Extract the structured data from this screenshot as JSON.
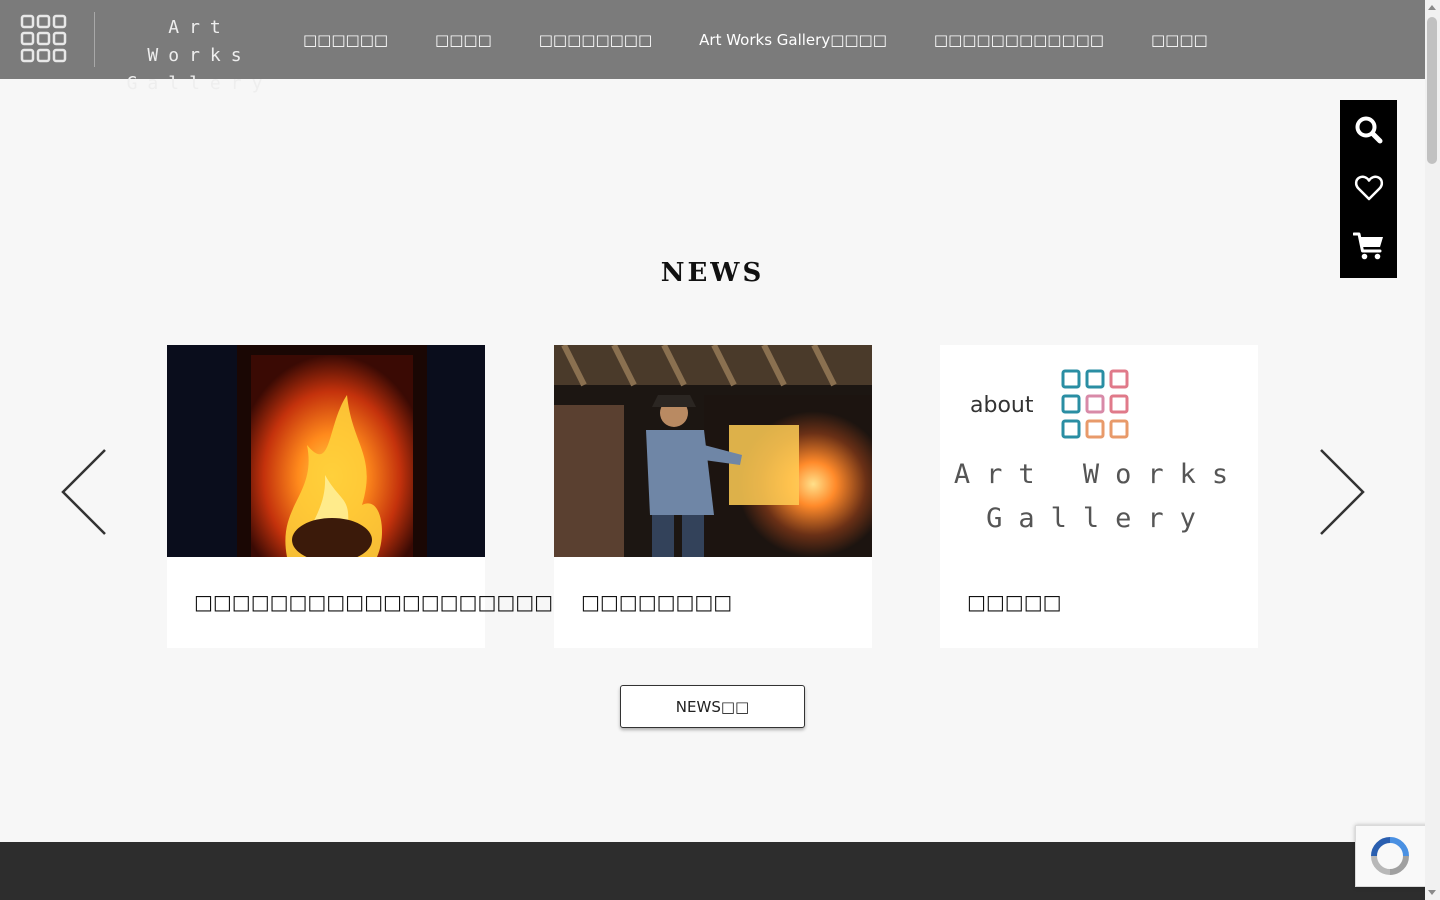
{
  "brand": {
    "logo_line1": "Art Works",
    "logo_line2": "Gallery"
  },
  "nav": {
    "items": [
      {
        "label": "□□□□□□"
      },
      {
        "label": "□□□□"
      },
      {
        "label": "□□□□□□□□"
      },
      {
        "label": "Art Works Gallery□□□□"
      },
      {
        "label": "□□□□□□□□□□□□"
      },
      {
        "label": "□□□□"
      }
    ]
  },
  "side_tools": {
    "icons": [
      "search-icon",
      "heart-icon",
      "cart-icon"
    ]
  },
  "news": {
    "title": "NEWS",
    "cards": [
      {
        "title": "□□□□□□□□□□□□□□□□□□□",
        "image": "kiln-fire-photo"
      },
      {
        "title": "□□□□□□□□",
        "image": "potter-at-kiln-photo"
      },
      {
        "title": "□□□□□",
        "image": "about-art-works-gallery-logo",
        "img_about": "about",
        "img_line1": "Art Works",
        "img_line2": "Gallery"
      }
    ],
    "more_button": "NEWS□□"
  },
  "colors": {
    "header_bg": "#7b7b7b",
    "page_bg": "#f7f7f7",
    "side_panel_bg": "#000000",
    "footer_bg": "#2d2d2d"
  }
}
